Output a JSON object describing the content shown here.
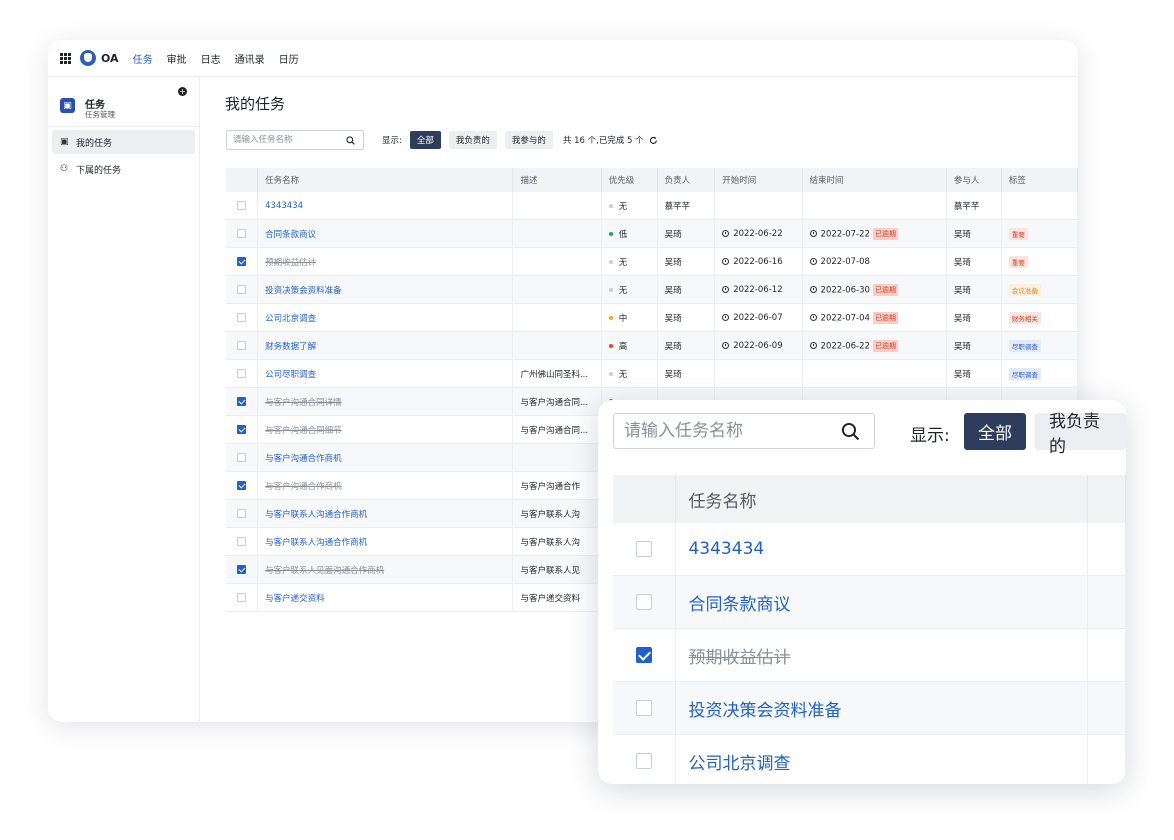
{
  "app": {
    "brand": "OA",
    "nav": [
      "任务",
      "审批",
      "日志",
      "通讯录",
      "日历"
    ],
    "active_nav": 0
  },
  "sidebar": {
    "title": "任务",
    "subtitle": "任务管理",
    "items": [
      {
        "label": "我的任务",
        "icon": "calendar-icon",
        "active": true
      },
      {
        "label": "下属的任务",
        "icon": "org-tree-icon",
        "active": false
      }
    ]
  },
  "main": {
    "title": "我的任务",
    "search_placeholder": "请输入任务名称",
    "show_label": "显示:",
    "filters": [
      "全部",
      "我负责的",
      "我参与的"
    ],
    "active_filter": 0,
    "count_text": "共 16 个,已完成 5 个"
  },
  "table": {
    "columns": [
      "任务名称",
      "描述",
      "优先级",
      "负责人",
      "开始时间",
      "结束时间",
      "参与人",
      "标签"
    ],
    "rows": [
      {
        "checked": false,
        "name": "4343434",
        "desc": "",
        "priority": "无",
        "priority_color": "#c9cdd4",
        "owner": "慕芊芊",
        "start": "",
        "end": "",
        "overdue": "",
        "participant": "慕芊芊",
        "tag": "",
        "tag_color": "",
        "tag_bg": ""
      },
      {
        "checked": false,
        "name": "合同条款商议",
        "desc": "",
        "priority": "低",
        "priority_color": "#1fa85a",
        "owner": "吴琦",
        "start": "2022-06-22",
        "end": "2022-07-22",
        "overdue": "已逾期",
        "participant": "吴琦",
        "tag": "重要",
        "tag_color": "#d8402a",
        "tag_bg": "#fbe3de"
      },
      {
        "checked": true,
        "name": "预期收益估计",
        "desc": "",
        "priority": "无",
        "priority_color": "#c9cdd4",
        "owner": "吴琦",
        "start": "2022-06-16",
        "end": "2022-07-08",
        "overdue": "",
        "participant": "吴琦",
        "tag": "重要",
        "tag_color": "#d8402a",
        "tag_bg": "#fbe3de"
      },
      {
        "checked": false,
        "name": "投资决策会资料准备",
        "desc": "",
        "priority": "无",
        "priority_color": "#c9cdd4",
        "owner": "吴琦",
        "start": "2022-06-12",
        "end": "2022-06-30",
        "overdue": "已逾期",
        "participant": "吴琦",
        "tag": "会议准备",
        "tag_color": "#e48a1c",
        "tag_bg": "#fcefdc"
      },
      {
        "checked": false,
        "name": "公司北京调查",
        "desc": "",
        "priority": "中",
        "priority_color": "#f0a818",
        "owner": "吴琦",
        "start": "2022-06-07",
        "end": "2022-07-04",
        "overdue": "已逾期",
        "participant": "吴琦",
        "tag": "财务相关",
        "tag_color": "#d8402a",
        "tag_bg": "#fbe3de"
      },
      {
        "checked": false,
        "name": "财务数据了解",
        "desc": "",
        "priority": "高",
        "priority_color": "#e8472e",
        "owner": "吴琦",
        "start": "2022-06-09",
        "end": "2022-06-22",
        "overdue": "已逾期",
        "participant": "吴琦",
        "tag": "尽职调查",
        "tag_color": "#2f5fd0",
        "tag_bg": "#e1e9fb"
      },
      {
        "checked": false,
        "name": "公司尽职调查",
        "desc": "广州佛山同圣科...",
        "priority": "无",
        "priority_color": "#c9cdd4",
        "owner": "吴琦",
        "start": "",
        "end": "",
        "overdue": "",
        "participant": "吴琦",
        "tag": "尽职调查",
        "tag_color": "#2f5fd0",
        "tag_bg": "#e1e9fb"
      },
      {
        "checked": true,
        "name": "与客户沟通合同详情",
        "desc": "与客户沟通合同...",
        "priority": "",
        "priority_color": "#e8472e",
        "owner": "",
        "start": "",
        "end": "",
        "overdue": "",
        "participant": "",
        "tag": "",
        "tag_color": "",
        "tag_bg": ""
      },
      {
        "checked": true,
        "name": "与客户沟通合同细节",
        "desc": "与客户沟通合同...",
        "priority": "",
        "priority_color": "",
        "owner": "",
        "start": "",
        "end": "",
        "overdue": "",
        "participant": "",
        "tag": "",
        "tag_color": "",
        "tag_bg": ""
      },
      {
        "checked": false,
        "name": "与客户沟通合作商机",
        "desc": "",
        "priority": "",
        "priority_color": "",
        "owner": "",
        "start": "",
        "end": "",
        "overdue": "",
        "participant": "",
        "tag": "",
        "tag_color": "",
        "tag_bg": ""
      },
      {
        "checked": true,
        "name": "与客户沟通合作商机",
        "desc": "与客户沟通合作",
        "priority": "",
        "priority_color": "",
        "owner": "",
        "start": "",
        "end": "",
        "overdue": "",
        "participant": "",
        "tag": "",
        "tag_color": "",
        "tag_bg": ""
      },
      {
        "checked": false,
        "name": "与客户联系人沟通合作商机",
        "desc": "与客户联系人沟",
        "priority": "",
        "priority_color": "",
        "owner": "",
        "start": "",
        "end": "",
        "overdue": "",
        "participant": "",
        "tag": "",
        "tag_color": "",
        "tag_bg": ""
      },
      {
        "checked": false,
        "name": "与客户联系人沟通合作商机",
        "desc": "与客户联系人沟",
        "priority": "",
        "priority_color": "",
        "owner": "",
        "start": "",
        "end": "",
        "overdue": "",
        "participant": "",
        "tag": "",
        "tag_color": "",
        "tag_bg": ""
      },
      {
        "checked": true,
        "name": "与客户联系人见面沟通合作商机",
        "desc": "与客户联系人见",
        "priority": "",
        "priority_color": "",
        "owner": "",
        "start": "",
        "end": "",
        "overdue": "",
        "participant": "",
        "tag": "",
        "tag_color": "",
        "tag_bg": ""
      },
      {
        "checked": false,
        "name": "与客户递交资料",
        "desc": "与客户递交资料",
        "priority": "",
        "priority_color": "",
        "owner": "",
        "start": "",
        "end": "",
        "overdue": "",
        "participant": "",
        "tag": "",
        "tag_color": "",
        "tag_bg": ""
      }
    ]
  },
  "zoom": {
    "search_placeholder": "请输入任务名称",
    "show_label": "显示:",
    "filters": [
      "全部",
      "我负责的"
    ],
    "active_filter": 0,
    "column": "任务名称",
    "rows": [
      {
        "checked": false,
        "name": "4343434"
      },
      {
        "checked": false,
        "name": "合同条款商议"
      },
      {
        "checked": true,
        "name": "预期收益估计"
      },
      {
        "checked": false,
        "name": "投资决策会资料准备"
      },
      {
        "checked": false,
        "name": "公司北京调查"
      }
    ]
  },
  "colors": {
    "accent": "#1f5fd1",
    "segment_active": "#2e3d5b",
    "overdue_bg": "#f5cfc8",
    "overdue_text": "#d8402a"
  }
}
